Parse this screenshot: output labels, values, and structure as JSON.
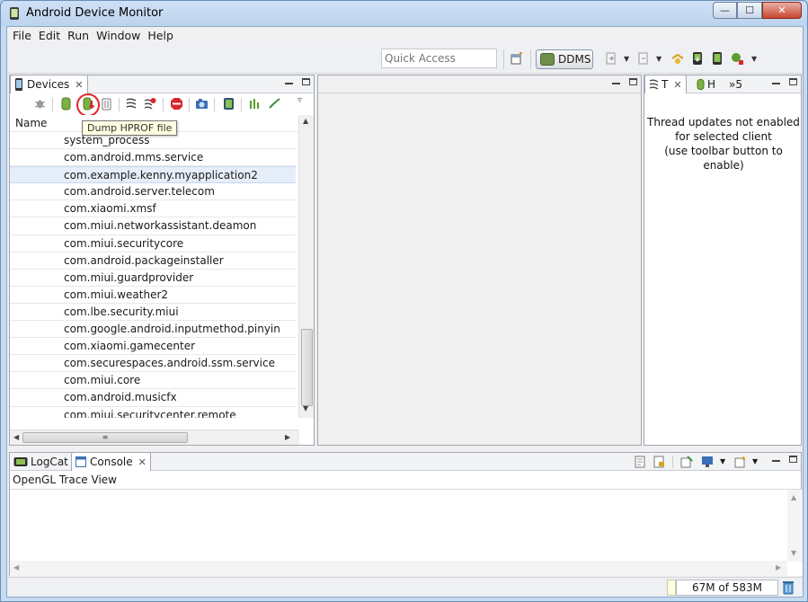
{
  "window": {
    "title": "Android Device Monitor"
  },
  "menu": [
    "File",
    "Edit",
    "Run",
    "Window",
    "Help"
  ],
  "toolbar": {
    "quick_access_placeholder": "Quick Access",
    "perspective_label": "DDMS"
  },
  "devices_panel": {
    "tab_label": "Devices",
    "column_header": "Name",
    "tooltip": "Dump HPROF file",
    "processes": [
      "system_process",
      "com.android.mms.service",
      "com.example.kenny.myapplication2",
      "com.android.server.telecom",
      "com.xiaomi.xmsf",
      "com.miui.networkassistant.deamon",
      "com.miui.securitycore",
      "com.android.packageinstaller",
      "com.miui.guardprovider",
      "com.miui.weather2",
      "com.lbe.security.miui",
      "com.google.android.inputmethod.pinyin",
      "com.xiaomi.gamecenter",
      "com.securespaces.android.ssm.service",
      "com.miui.core",
      "com.android.musicfx",
      "com.miui.securitycenter.remote"
    ],
    "selected_process": "com.example.kenny.myapplication2"
  },
  "threads_panel": {
    "tab_threads": "T",
    "tab_heap": "H",
    "tab_overflow": "»5",
    "message_lines": [
      "Thread updates not enabled",
      "for selected client",
      "(use toolbar button to enable)"
    ]
  },
  "console_panel": {
    "tab_logcat": "LogCat",
    "tab_console": "Console",
    "view_title": "OpenGL Trace View"
  },
  "status": {
    "heap": "67M of 583M"
  },
  "colors": {
    "titlebar": "#bcd3ee",
    "selection": "#e5eef9",
    "highlight_ring": "#e0242a",
    "tooltip_bg": "#ffffe1"
  }
}
